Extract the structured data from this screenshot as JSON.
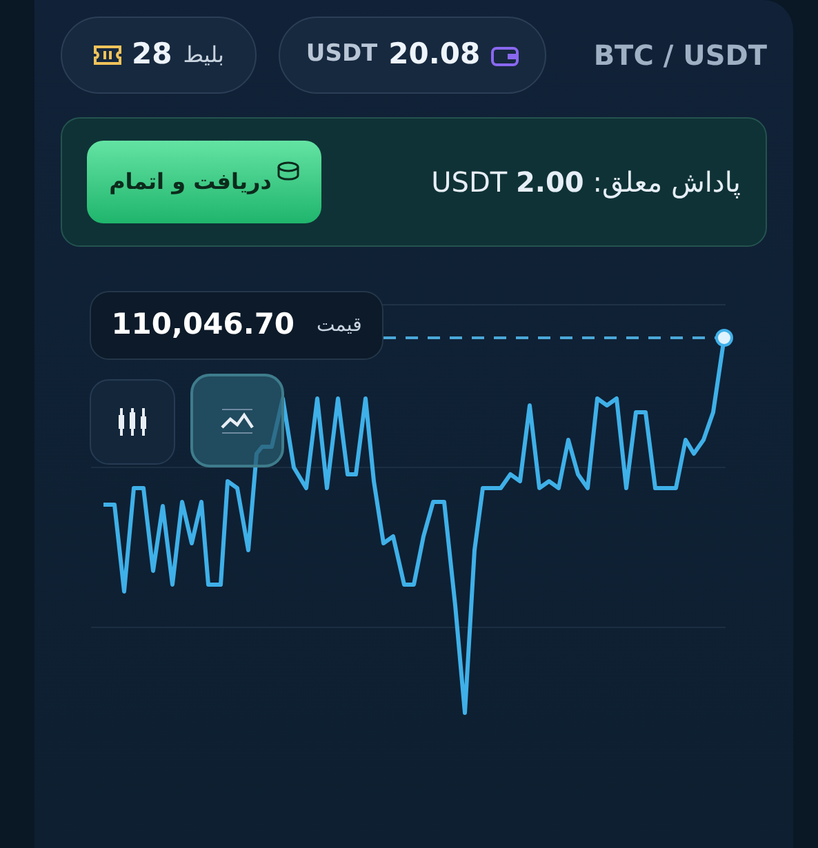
{
  "header": {
    "pair": "BTC / USDT",
    "wallet": {
      "amount": "20.08",
      "currency": "USDT"
    },
    "tickets": {
      "count": "28",
      "label": "بلیط"
    }
  },
  "reward": {
    "label": "پاداش معلق:",
    "amount": "2.00",
    "currency": "USDT",
    "button": "دریافت و اتمام"
  },
  "chart": {
    "price_label": "قیمت",
    "price": "110,046.70",
    "chart_types": [
      {
        "kind": "candles",
        "selected": false
      },
      {
        "kind": "line",
        "selected": true
      }
    ]
  }
}
